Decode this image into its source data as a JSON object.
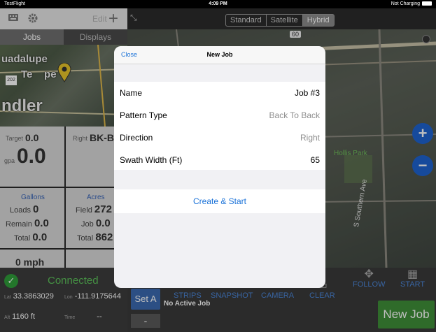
{
  "status_bar": {
    "carrier": "TestFlight",
    "time": "4:09 PM",
    "battery": "Not Charging"
  },
  "toolbar": {
    "edit_label": "Edit",
    "plus_label": "+"
  },
  "tabs": [
    {
      "label": "Jobs"
    },
    {
      "label": "Displays"
    }
  ],
  "map_type": {
    "options": [
      "Standard",
      "Satellite",
      "Hybrid"
    ],
    "selected": "Hybrid"
  },
  "mini_map": {
    "city_top": "uadalupe",
    "city_mid": "Te    pe",
    "city_bottom": "ndler",
    "shield": "202"
  },
  "gauges": {
    "target_label": "Target",
    "target_value": "0.0",
    "right_label": "Right",
    "right_value": "BK-BK",
    "gpa_label": "gpa",
    "gpa_value": "0.0",
    "gallons_title": "Gallons",
    "loads_label": "Loads",
    "loads_value": "0",
    "remain_label": "Remain",
    "remain_value": "0.0",
    "total_gal_label": "Total",
    "total_gal_value": "0.0",
    "acres_title": "Acres",
    "field_label": "Field",
    "field_value": "272",
    "job_label": "Job",
    "job_value": "0.0",
    "total_acres_label": "Total",
    "total_acres_value": "862",
    "speed_value": "0 mph"
  },
  "status_panel": {
    "connected": "Connected",
    "lat_label": "Lat",
    "lat_value": "33.3863029",
    "lon_label": "Lon",
    "lon_value": "-111.9175644",
    "alt_label": "Alt",
    "alt_value": "1160 ft",
    "time_label": "Time",
    "time_value": "--"
  },
  "bottom_bar": {
    "set_a": "Set A",
    "minus": "-",
    "no_active_job": "No Active Job",
    "tools": [
      "STRIPS",
      "SNAPSHOT",
      "CAMERA",
      "CLEAR",
      "FOLLOW",
      "START"
    ],
    "new_job": "New Job"
  },
  "big_map": {
    "route_60": "60",
    "park_label": "Hollis Park",
    "street_label": "S Southern Ave"
  },
  "modal": {
    "close_label": "Close",
    "title": "New Job",
    "fields": [
      {
        "label": "Name",
        "value": "Job #3"
      },
      {
        "label": "Pattern Type",
        "value": "Back To Back"
      },
      {
        "label": "Direction",
        "value": "Right"
      },
      {
        "label": "Swath Width (Ft)",
        "value": "65"
      }
    ],
    "create_label": "Create & Start"
  }
}
